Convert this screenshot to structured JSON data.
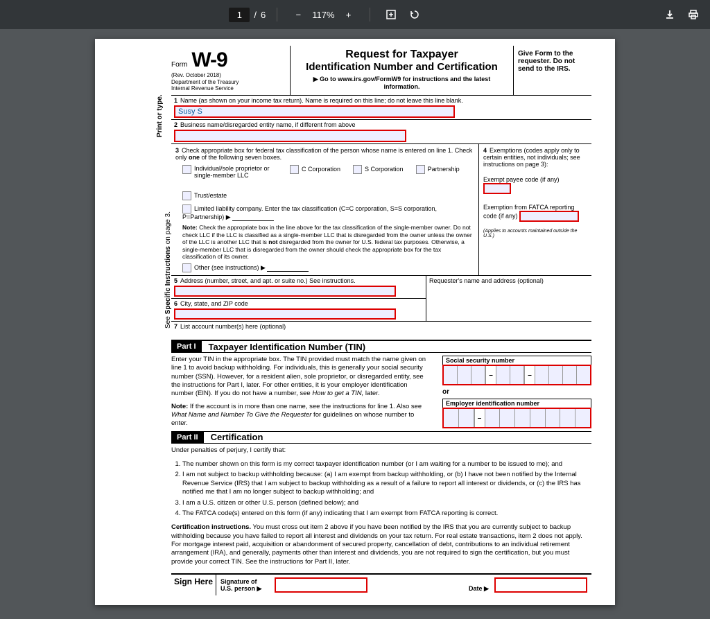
{
  "toolbar": {
    "page": "1",
    "total": "6",
    "zoom": "117%"
  },
  "header": {
    "form": "Form",
    "num": "W-9",
    "rev": "(Rev. October 2018)",
    "dept": "Department of the Treasury",
    "irs": "Internal Revenue Service",
    "title1": "Request for Taxpayer",
    "title2": "Identification Number and Certification",
    "goto": "▶ Go to www.irs.gov/FormW9 for instructions and the latest information.",
    "give": "Give Form to the requester. Do not send to the IRS."
  },
  "side": {
    "a": "Print or type.",
    "b": "See Specific Instructions on page 3."
  },
  "l1": {
    "num": "1",
    "txt": "Name (as shown on your income tax return). Name is required on this line; do not leave this line blank.",
    "val": "Susy S"
  },
  "l2": {
    "num": "2",
    "txt": "Business name/disregarded entity name, if different from above"
  },
  "l3": {
    "num": "3",
    "txt": "Check appropriate box for federal tax classification of the person whose name is entered on line 1. Check only one of the following seven boxes.",
    "a": "Individual/sole proprietor or single-member LLC",
    "b": "C Corporation",
    "c": "S Corporation",
    "d": "Partnership",
    "e": "Trust/estate",
    "f": "Limited liability company. Enter the tax classification (C=C corporation, S=S corporation, P=Partnership) ▶",
    "note": "Note: Check the appropriate box in the line above for the tax classification of the single-member owner. Do not check LLC if the LLC is classified as a single-member LLC that is disregarded from the owner unless the owner of the LLC is another LLC that is not disregarded from the owner for U.S. federal tax purposes. Otherwise, a single-member LLC that is disregarded from the owner should check the appropriate box for the tax classification of its owner.",
    "g": "Other (see instructions) ▶"
  },
  "l4": {
    "num": "4",
    "txt": "Exemptions (codes apply only to certain entities, not individuals; see instructions on page 3):",
    "a": "Exempt payee code (if any)",
    "b": "Exemption from FATCA reporting code (if any)",
    "c": "(Applies to accounts maintained outside the U.S.)"
  },
  "l5": {
    "num": "5",
    "txt": "Address (number, street, and apt. or suite no.) See instructions."
  },
  "req": "Requester's name and address (optional)",
  "l6": {
    "num": "6",
    "txt": "City, state, and ZIP code"
  },
  "l7": {
    "num": "7",
    "txt": "List account number(s) here (optional)"
  },
  "p1": {
    "label": "Part I",
    "title": "Taxpayer Identification Number (TIN)",
    "p1": "Enter your TIN in the appropriate box. The TIN provided must match the name given on line 1 to avoid backup withholding. For individuals, this is generally your social security number (SSN). However, for a resident alien, sole proprietor, or disregarded entity, see the instructions for Part I, later. For other entities, it is your employer identification number (EIN). If you do not have a number, see How to get a TIN, later.",
    "p2": "Note: If the account is in more than one name, see the instructions for line 1. Also see What Name and Number To Give the Requester for guidelines on whose number to enter.",
    "ssn": "Social security number",
    "or": "or",
    "ein": "Employer identification number"
  },
  "p2": {
    "label": "Part II",
    "title": "Certification",
    "lead": "Under penalties of perjury, I certify that:",
    "i1": "The number shown on this form is my correct taxpayer identification number (or I am waiting for a number to be issued to me); and",
    "i2": "I am not subject to backup withholding because: (a) I am exempt from backup withholding, or (b) I have not been notified by the Internal Revenue Service (IRS) that I am subject to backup withholding as a result of a failure to report all interest or dividends, or (c) the IRS has notified me that I am no longer subject to backup withholding; and",
    "i3": "I am a U.S. citizen or other U.S. person (defined below); and",
    "i4": "The FATCA code(s) entered on this form (if any) indicating that I am exempt from FATCA reporting is correct.",
    "ci": "Certification instructions. You must cross out item 2 above if you have been notified by the IRS that you are currently subject to backup withholding because you have failed to report all interest and dividends on your tax return. For real estate transactions, item 2 does not apply. For mortgage interest paid, acquisition or abandonment of secured property, cancellation of debt, contributions to an individual retirement arrangement (IRA), and generally, payments other than interest and dividends, you are not required to sign the certification, but you must provide your correct TIN. See the instructions for Part II, later."
  },
  "sign": {
    "here": "Sign Here",
    "sig": "Signature of U.S. person ▶",
    "date": "Date ▶"
  }
}
